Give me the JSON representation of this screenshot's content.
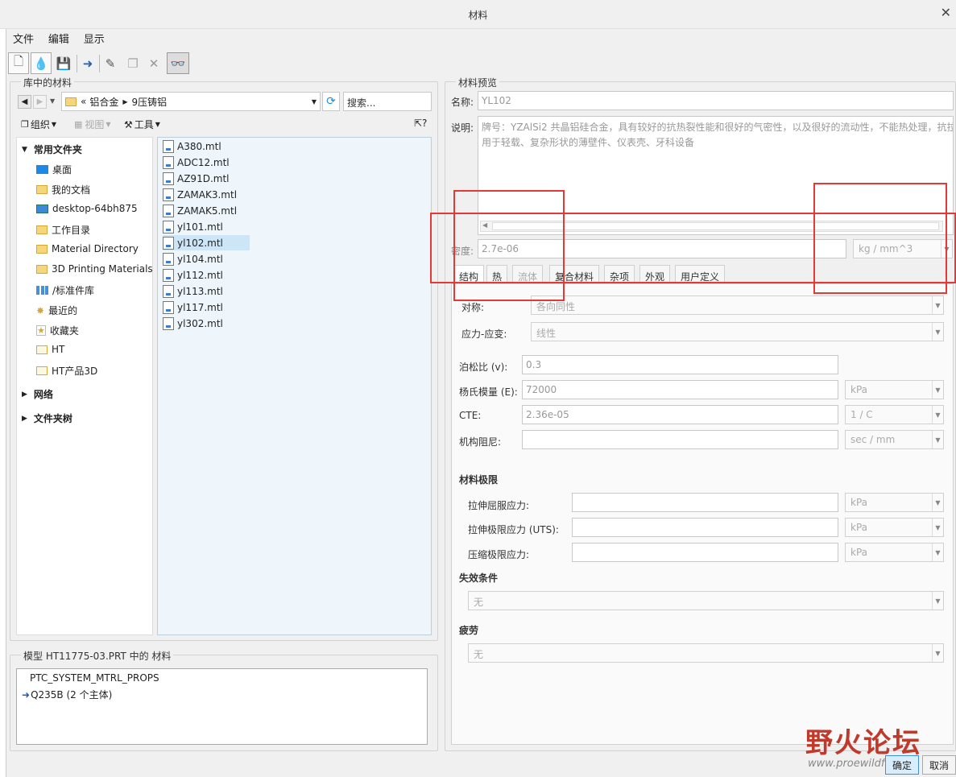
{
  "window": {
    "title": "材料"
  },
  "menu": [
    "文件",
    "编辑",
    "显示"
  ],
  "toolbar_icons": [
    "new-material-icon",
    "new-fluid-icon",
    "save-icon",
    "assign-arrow-icon",
    "edit-pencil-icon",
    "copy-icon",
    "delete-x-icon",
    "preview-glasses-icon"
  ],
  "library": {
    "group_label": "库中的材料",
    "path": {
      "prefix": "«",
      "segments": [
        "铝合金",
        "9压铸铝"
      ]
    },
    "search_placeholder": "搜索...",
    "view_toolbar": {
      "organize": "组织",
      "view": "视图",
      "tools": "工具"
    },
    "tree": {
      "favorites_header": "常用文件夹",
      "items": [
        "桌面",
        "我的文档",
        "desktop-64bh875",
        "工作目录",
        "Material Directory",
        "3D Printing Materials",
        "/标准件库",
        "最近的",
        "收藏夹",
        "HT",
        "HT产品3D"
      ],
      "network": "网络",
      "folder_tree": "文件夹树"
    },
    "files": [
      "A380.mtl",
      "ADC12.mtl",
      "AZ91D.mtl",
      "ZAMAK3.mtl",
      "ZAMAK5.mtl",
      "yl101.mtl",
      "yl102.mtl",
      "yl104.mtl",
      "yl112.mtl",
      "yl113.mtl",
      "yl117.mtl",
      "yl302.mtl"
    ],
    "selected_file": "yl102.mtl"
  },
  "model": {
    "group_label": "模型 HT11775-03.PRT 中的 材料",
    "items": [
      "PTC_SYSTEM_MTRL_PROPS",
      "Q235B (2 个主体)"
    ]
  },
  "preview": {
    "group_label": "材料预览",
    "name_label": "名称:",
    "name_value": "YL102",
    "desc_label": "说明:",
    "desc_line1": "牌号：YZAlSi2 共晶铝硅合金，具有较好的抗热裂性能和很好的气密性，以及很好的流动性，不能热处理，抗拉",
    "desc_line2": "用于轻载、复杂形状的薄壁件、仪表壳、牙科设备",
    "density_label": "密度:",
    "density_value": "2.7e-06",
    "density_unit": "kg / mm^3",
    "tabs": [
      "结构",
      "热",
      "流体",
      "复合材料",
      "杂项",
      "外观",
      "用户定义"
    ],
    "symmetry_label": "对称:",
    "symmetry_value": "各向同性",
    "stress_strain_label": "应力-应变:",
    "stress_strain_value": "线性",
    "poisson_label": "泊松比 (v):",
    "poisson_value": "0.3",
    "young_label": "杨氏模量 (E):",
    "young_value": "72000",
    "young_unit": "kPa",
    "cte_label": "CTE:",
    "cte_value": "2.36e-05",
    "cte_unit": "1 / C",
    "damping_label": "机构阻尼:",
    "damping_unit": "sec / mm",
    "limits_header": "材料极限",
    "tensile_yield_label": "拉伸屈服应力:",
    "tensile_ult_label": "拉伸极限应力 (UTS):",
    "compress_label": "压缩极限应力:",
    "limit_unit": "kPa",
    "failure_header": "失效条件",
    "failure_value": "无",
    "fatigue_header": "疲劳",
    "fatigue_value": "无"
  },
  "watermark": {
    "text": "野火论坛",
    "url": "www.proewildfire.cn"
  },
  "buttons": {
    "ok": "确定",
    "cancel": "取消"
  },
  "colors": {
    "highlight_box": "#e53935",
    "selected_row": "#cde6f7",
    "file_panel": "#eef6fb"
  }
}
